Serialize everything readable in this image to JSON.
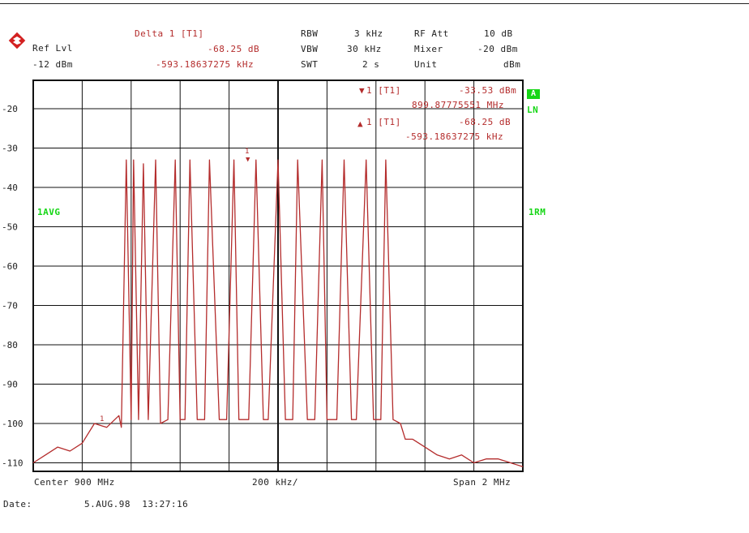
{
  "header": {
    "ref_lvl_label": "Ref Lvl",
    "ref_lvl_value": "-12 dBm",
    "delta_label": "Delta 1 [T1]",
    "delta_db": "-68.25 dB",
    "delta_freq": "-593.18637275 kHz",
    "rbw_label": "RBW",
    "rbw_value": "3 kHz",
    "vbw_label": "VBW",
    "vbw_value": "30 kHz",
    "swt_label": "SWT",
    "swt_value": "2 s",
    "rfatt_label": "RF Att",
    "rfatt_value": "10 dB",
    "mixer_label": "Mixer",
    "mixer_value": "-20 dBm",
    "unit_label": "Unit",
    "unit_value": "dBm"
  },
  "markers": {
    "m1_label": "1 [T1]",
    "m1_level": "-33.53 dBm",
    "m1_freq": "899.87775551 MHz",
    "d1_label": "1 [T1]",
    "d1_level": "-68.25 dB",
    "d1_freq": "-593.18637275 kHz",
    "marker_tag": "1"
  },
  "side_labels": {
    "badge_a": "A",
    "ln": "LN",
    "avg": "1AVG",
    "rm": "1RM"
  },
  "footer": {
    "center": "Center 900 MHz",
    "div": "200 kHz/",
    "span": "Span 2 MHz",
    "date_label": "Date:",
    "date_value": "5.AUG.98  13:27:16"
  },
  "colors": {
    "trace": "#b42c2c",
    "grid": "#111111",
    "status_green": "#16d616"
  },
  "chart_data": {
    "type": "line",
    "title": "",
    "xlabel": "",
    "ylabel": "",
    "x_unit": "MHz",
    "y_unit": "dBm",
    "xlim": [
      899.0,
      901.0
    ],
    "ylim": [
      -112,
      -10
    ],
    "y_ticks": [
      -20,
      -30,
      -40,
      -50,
      -60,
      -70,
      -80,
      -90,
      -100,
      -110
    ],
    "y_tick_labels": [
      "-20",
      "-30",
      "-40",
      "-50",
      "-60",
      "-70",
      "-80",
      "-90",
      "-100",
      "-110"
    ],
    "grid": true,
    "series": [
      {
        "x": [
          899.0,
          899.05,
          899.1,
          899.15,
          899.2,
          899.25,
          899.3,
          899.35,
          899.36,
          899.38,
          899.4,
          899.41,
          899.43,
          899.45,
          899.47,
          899.5,
          899.52,
          899.55,
          899.58,
          899.6,
          899.62,
          899.64,
          899.67,
          899.7,
          899.72,
          899.76,
          899.79,
          899.82,
          899.84,
          899.88,
          899.91,
          899.94,
          899.96,
          900.0,
          900.03,
          900.06,
          900.08,
          900.12,
          900.15,
          900.18,
          900.2,
          900.24,
          900.27,
          900.3,
          900.32,
          900.36,
          900.39,
          900.42,
          900.44,
          900.47,
          900.5,
          900.52,
          900.55,
          900.6,
          900.65,
          900.7,
          900.75,
          900.8,
          900.85,
          900.9,
          900.95,
          901.0
        ],
        "y": [
          -110,
          -108,
          -106,
          -107,
          -105,
          -100,
          -101,
          -98,
          -101,
          -33,
          -99,
          -33,
          -99,
          -34,
          -99,
          -33,
          -100,
          -99,
          -33,
          -99,
          -99,
          -33,
          -99,
          -99,
          -33,
          -99,
          -99,
          -33,
          -99,
          -99,
          -33,
          -99,
          -99,
          -33,
          -99,
          -99,
          -33,
          -99,
          -99,
          -33,
          -99,
          -99,
          -33,
          -99,
          -99,
          -33,
          -99,
          -99,
          -33,
          -99,
          -100,
          -104,
          -104,
          -106,
          -108,
          -109,
          -108,
          -110,
          -109,
          -109,
          -110,
          -111
        ]
      }
    ]
  }
}
